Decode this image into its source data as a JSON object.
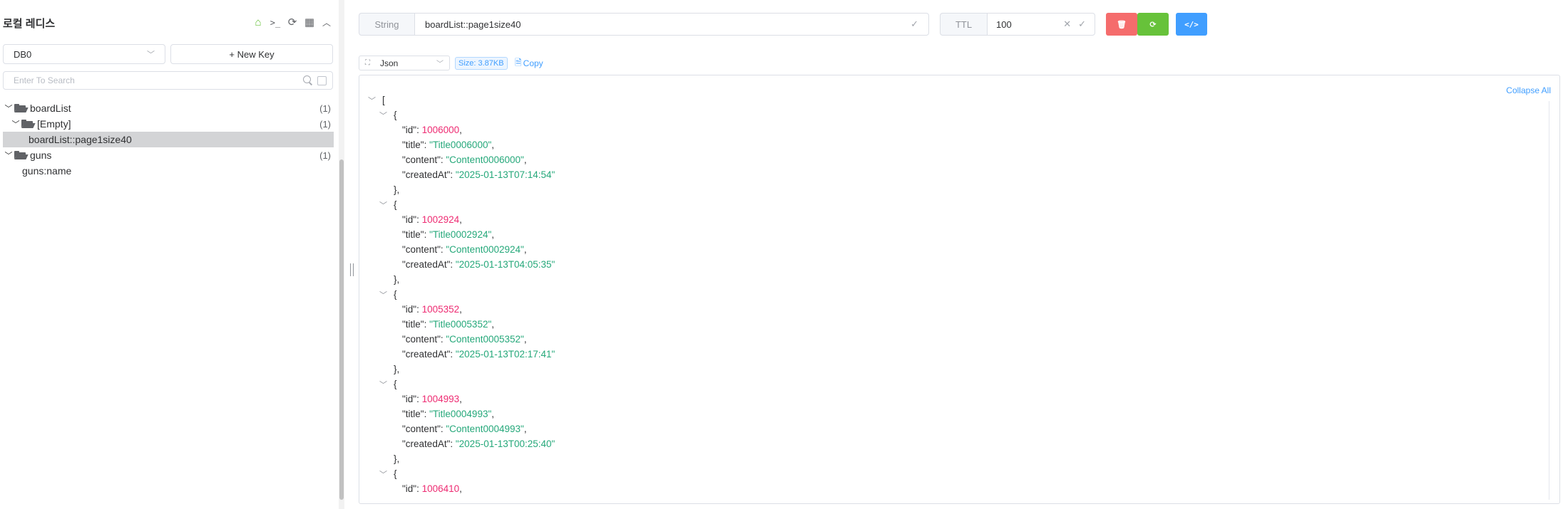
{
  "sidebar": {
    "connection_name": "로컬 레디스",
    "db_select": "DB0",
    "new_key_label": "+ New Key",
    "search_placeholder": "Enter To Search",
    "tree": [
      {
        "label": "boardList",
        "count": "(1)"
      },
      {
        "label": "[Empty]",
        "count": "(1)"
      },
      {
        "label": "boardList::page1size40"
      },
      {
        "label": "guns",
        "count": "(1)"
      },
      {
        "label": "guns:name"
      }
    ]
  },
  "key_bar": {
    "type": "String",
    "key_name": "boardList::page1size40",
    "ttl_label": "TTL",
    "ttl_value": "100"
  },
  "viewer_toolbar": {
    "format": "Json",
    "size": "Size: 3.87KB",
    "copy": "Copy"
  },
  "viewer": {
    "collapse_all": "Collapse All",
    "open_bracket": "[",
    "items": [
      {
        "id": "1006000",
        "title": "\"Title0006000\"",
        "content": "\"Content0006000\"",
        "createdAt": "\"2025-01-13T07:14:54\""
      },
      {
        "id": "1002924",
        "title": "\"Title0002924\"",
        "content": "\"Content0002924\"",
        "createdAt": "\"2025-01-13T04:05:35\""
      },
      {
        "id": "1005352",
        "title": "\"Title0005352\"",
        "content": "\"Content0005352\"",
        "createdAt": "\"2025-01-13T02:17:41\""
      },
      {
        "id": "1004993",
        "title": "\"Title0004993\"",
        "content": "\"Content0004993\"",
        "createdAt": "\"2025-01-13T00:25:40\""
      }
    ],
    "partial_item_id": "1006410"
  },
  "colors": {
    "number": "#ee2b72",
    "string": "#25a87a",
    "link": "#409eff",
    "delete": "#f56c6c",
    "refresh": "#67c23a",
    "code": "#409eff"
  }
}
